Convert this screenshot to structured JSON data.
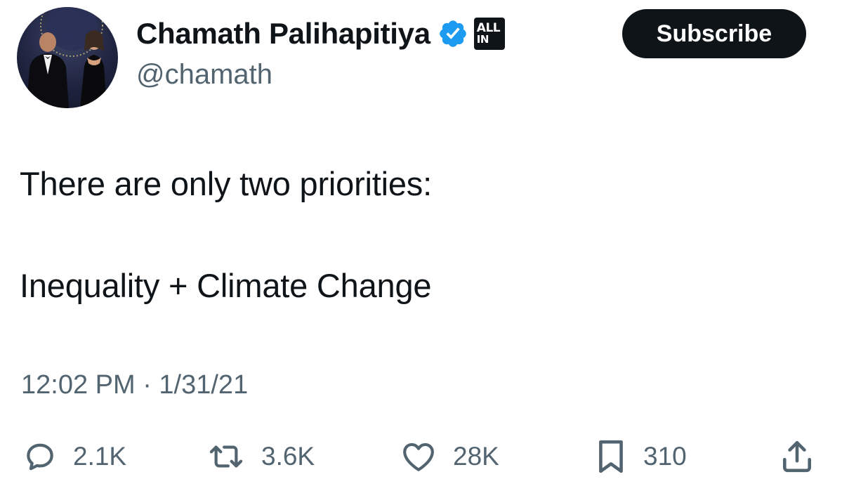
{
  "author": {
    "display_name": "Chamath Palihapitiya",
    "handle": "@chamath",
    "affiliate_badge": [
      "ALL",
      "IN"
    ],
    "verified_color": "#1d9bf0"
  },
  "header": {
    "subscribe_label": "Subscribe"
  },
  "tweet": {
    "lines": [
      "There are only two priorities:",
      "Inequality + Climate Change"
    ],
    "timestamp": "12:02 PM · 1/31/21"
  },
  "actions": {
    "reply": {
      "icon": "reply-icon",
      "count": "2.1K"
    },
    "retweet": {
      "icon": "retweet-icon",
      "count": "3.6K"
    },
    "like": {
      "icon": "heart-icon",
      "count": "28K"
    },
    "bookmark": {
      "icon": "bookmark-icon",
      "count": "310"
    },
    "share": {
      "icon": "share-icon"
    }
  },
  "colors": {
    "text_primary": "#0f1419",
    "text_secondary": "#536471",
    "button_bg": "#0f1419",
    "button_text": "#ffffff"
  }
}
